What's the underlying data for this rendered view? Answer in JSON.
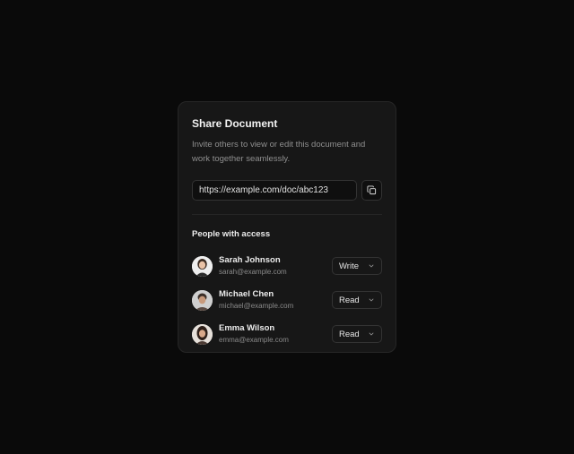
{
  "dialog": {
    "title": "Share Document",
    "description": "Invite others to view or edit this document and work together seamlessly.",
    "link_value": "https://example.com/doc/abc123"
  },
  "access": {
    "section_title": "People with access",
    "people": [
      {
        "name": "Sarah Johnson",
        "email": "sarah@example.com",
        "permission": "Write"
      },
      {
        "name": "Michael Chen",
        "email": "michael@example.com",
        "permission": "Read"
      },
      {
        "name": "Emma Wilson",
        "email": "emma@example.com",
        "permission": "Read"
      }
    ]
  },
  "colors": {
    "background": "#0a0a0a",
    "card": "#171717",
    "border": "#262626"
  },
  "icons": [
    "copy-icon",
    "chevron-down-icon"
  ]
}
